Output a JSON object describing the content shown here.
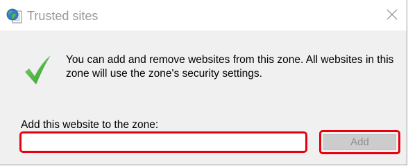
{
  "window": {
    "title": "Trusted sites",
    "title_icon": "globe-page-icon",
    "close_icon": "close-icon"
  },
  "message": {
    "icon": "checkmark-icon",
    "text": "You can add and remove websites from this zone. All websites in this zone will use the zone's security settings."
  },
  "add_site": {
    "label": "Add this website to the zone:",
    "input_value": "",
    "button_label": "Add",
    "button_enabled": false
  },
  "colors": {
    "highlight": "#e8000e",
    "check_green": "#3fb33a",
    "title_text": "#9a9a9a",
    "dialog_bg": "#f0f0f0"
  }
}
